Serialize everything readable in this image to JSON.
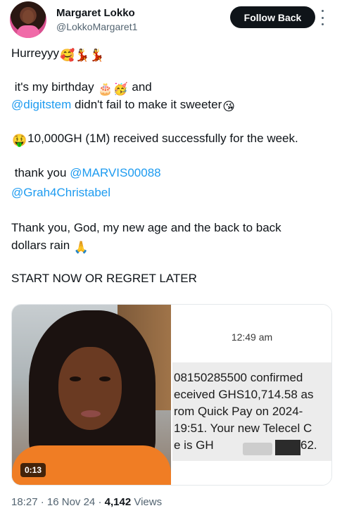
{
  "author": {
    "name": "Margaret Lokko",
    "handle": "@LokkoMargaret1",
    "follow_label": "Follow Back"
  },
  "tweet": {
    "l1": "Hurreyyy",
    "l1_emoji": "🥰💃💃",
    "l2a": "it's my birthday",
    "l2_emoji": "🎂🥳",
    "l2b": "and",
    "l3_mention": "@digitstem",
    "l3_text": "didn't fail to make it sweeter",
    "l3_emoji": "😘",
    "l4_emoji": "🤑",
    "l4_text": "10,000GH (1M) received successfully for the week.",
    "l5_text": "thank you",
    "l5_mention": "@MARVIS00088",
    "l6_mention": "@Grah4Christabel",
    "l7": "Thank you, God, my new age and the back to back",
    "l8": "dollars rain",
    "l8_emoji": "🙏",
    "l9": "START NOW OR REGRET LATER"
  },
  "media": {
    "video_duration": "0:13",
    "sms_time": "12:49 am",
    "sms_lines": [
      "08150285500 confirmed",
      "eceived GHS10,714.58 as",
      "rom Quick Pay on 2024-",
      "19:51. Your new Telecel C",
      "e is GH",
      "62."
    ]
  },
  "meta": {
    "time": "18:27",
    "sep1": "·",
    "date": "16 Nov 24",
    "sep2": "·",
    "views_count": "4,142",
    "views_label": "Views"
  },
  "colors": {
    "accent": "#1d9bf0",
    "text": "#0f1419",
    "muted": "#536471"
  }
}
